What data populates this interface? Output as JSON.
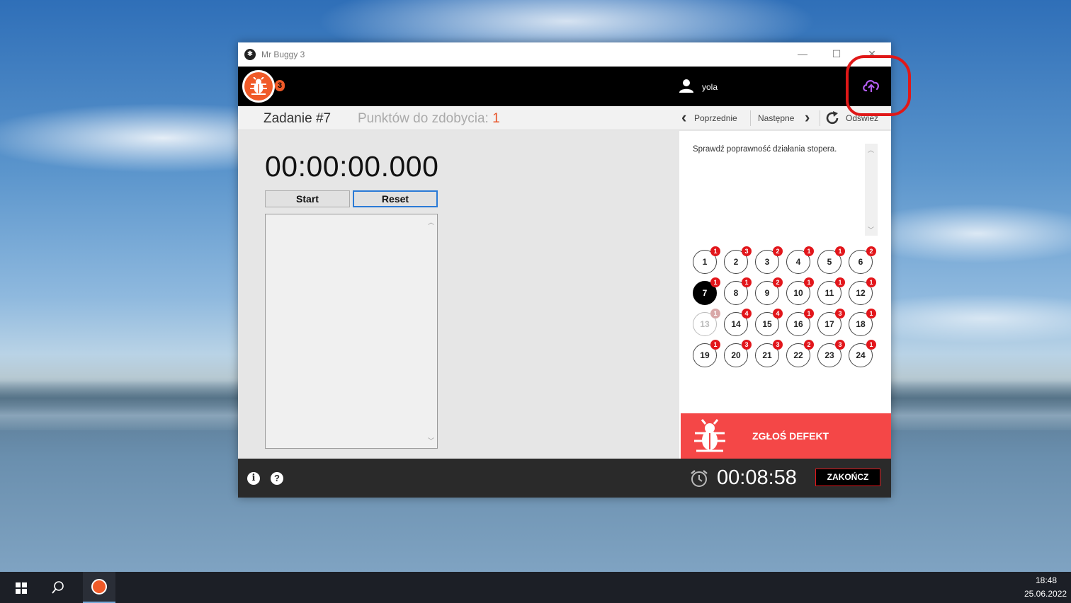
{
  "window": {
    "title": "Mr Buggy 3",
    "minimize_glyph": "—",
    "maximize_glyph": "☐",
    "close_glyph": "✕"
  },
  "header": {
    "logo_badge": "3",
    "user_icon": "user-icon",
    "username": "yola",
    "upload_icon": "cloud-upload-icon",
    "accent_color": "#f05a28"
  },
  "task": {
    "title": "Zadanie #7",
    "points_label": "Punktów do zdobycia:",
    "points_value": "1"
  },
  "nav": {
    "prev_label": "Poprzednie",
    "next_label": "Następne",
    "refresh_label": "Odśwież"
  },
  "stopwatch": {
    "display": "00:00:00.000",
    "start_label": "Start",
    "reset_label": "Reset"
  },
  "description": {
    "text": "Sprawdź poprawność działania stopera."
  },
  "tasks": [
    {
      "number": "1",
      "badge": "1",
      "state": "normal"
    },
    {
      "number": "2",
      "badge": "3",
      "state": "normal"
    },
    {
      "number": "3",
      "badge": "2",
      "state": "normal"
    },
    {
      "number": "4",
      "badge": "1",
      "state": "normal"
    },
    {
      "number": "5",
      "badge": "1",
      "state": "normal"
    },
    {
      "number": "6",
      "badge": "2",
      "state": "normal"
    },
    {
      "number": "7",
      "badge": "1",
      "state": "current"
    },
    {
      "number": "8",
      "badge": "1",
      "state": "normal"
    },
    {
      "number": "9",
      "badge": "2",
      "state": "normal"
    },
    {
      "number": "10",
      "badge": "1",
      "state": "normal"
    },
    {
      "number": "11",
      "badge": "1",
      "state": "normal"
    },
    {
      "number": "12",
      "badge": "1",
      "state": "normal"
    },
    {
      "number": "13",
      "badge": "1",
      "state": "disabled"
    },
    {
      "number": "14",
      "badge": "4",
      "state": "normal"
    },
    {
      "number": "15",
      "badge": "4",
      "state": "normal"
    },
    {
      "number": "16",
      "badge": "1",
      "state": "normal"
    },
    {
      "number": "17",
      "badge": "3",
      "state": "normal"
    },
    {
      "number": "18",
      "badge": "1",
      "state": "normal"
    },
    {
      "number": "19",
      "badge": "1",
      "state": "normal"
    },
    {
      "number": "20",
      "badge": "3",
      "state": "normal"
    },
    {
      "number": "21",
      "badge": "3",
      "state": "normal"
    },
    {
      "number": "22",
      "badge": "2",
      "state": "normal"
    },
    {
      "number": "23",
      "badge": "3",
      "state": "normal"
    },
    {
      "number": "24",
      "badge": "1",
      "state": "normal"
    }
  ],
  "report": {
    "label": "ZGŁOŚ DEFEKT",
    "color": "#f44747"
  },
  "footer": {
    "info_glyph": "i",
    "help_glyph": "?",
    "timer": "00:08:58",
    "end_label": "ZAKOŃCZ"
  },
  "taskbar": {
    "time": "18:48",
    "date": "25.06.2022"
  }
}
